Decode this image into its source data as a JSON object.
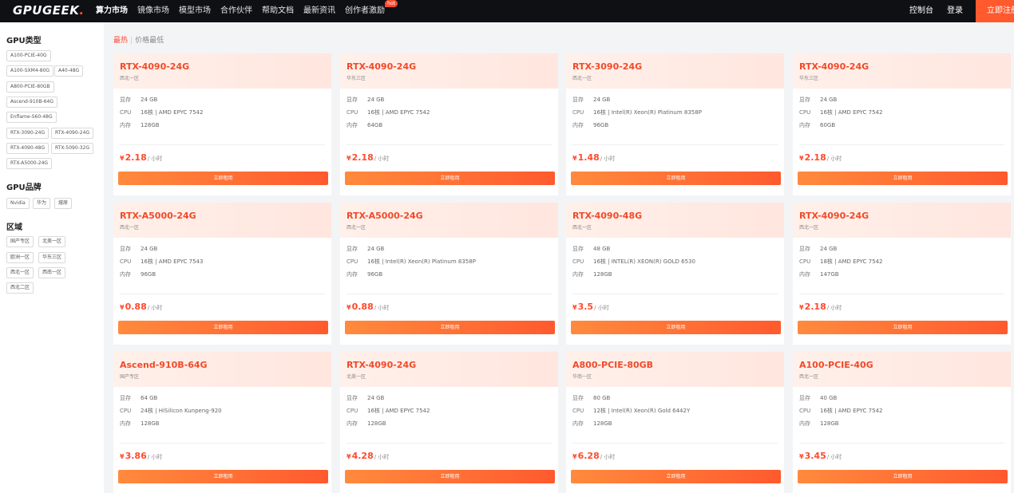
{
  "header": {
    "logo_text": "GPUGEEK",
    "logo_dot": ".",
    "nav": [
      {
        "label": "算力市场"
      },
      {
        "label": "镜像市场"
      },
      {
        "label": "模型市场"
      },
      {
        "label": "合作伙伴"
      },
      {
        "label": "帮助文档"
      },
      {
        "label": "最新资讯"
      },
      {
        "label": "创作者激励",
        "badge": "hot"
      }
    ],
    "console": "控制台",
    "login": "登录",
    "register": "立即注册"
  },
  "sidebar": {
    "gpu_type_title": "GPU类型",
    "gpu_types": [
      "A100-PCIE-40G",
      "A100-SXM4-80G",
      "A40-48G",
      "A800-PCIE-80GB",
      "Ascend-910B-64G",
      "Enflame-S60-48G",
      "RTX-3090-24G",
      "RTX-4090-24G",
      "RTX-4090-48G",
      "RTX-5090-32G",
      "RTX-A5000-24G"
    ],
    "brand_title": "GPU品牌",
    "brands": [
      "Nvidia",
      "华为",
      "燧原"
    ],
    "region_title": "区域",
    "regions": [
      "国产专区",
      "北美一区",
      "欧洲一区",
      "华东三区",
      "西北一区",
      "西南一区",
      "西北二区"
    ]
  },
  "sort": {
    "active": "最热",
    "separator": "|",
    "other": "价格最低"
  },
  "labels": {
    "vram": "显存",
    "cpu": "CPU",
    "mem": "内存",
    "currency": "¥",
    "unit": "/ 小时",
    "rent": "立即租用"
  },
  "cards": [
    {
      "name": "RTX-4090-24G",
      "region": "西北一区",
      "vram": "24 GB",
      "cpu": "16核 | AMD EPYC 7542",
      "mem": "128GB",
      "price": "2.18"
    },
    {
      "name": "RTX-4090-24G",
      "region": "华东三区",
      "vram": "24 GB",
      "cpu": "16核 | AMD EPYC 7542",
      "mem": "64GB",
      "price": "2.18"
    },
    {
      "name": "RTX-3090-24G",
      "region": "西北一区",
      "vram": "24 GB",
      "cpu": "16核 | Intel(R) Xeon(R) Platinum 8358P",
      "mem": "96GB",
      "price": "1.48"
    },
    {
      "name": "RTX-4090-24G",
      "region": "华东三区",
      "vram": "24 GB",
      "cpu": "16核 | AMD EPYC 7542",
      "mem": "60GB",
      "price": "2.18"
    },
    {
      "name": "RTX-A5000-24G",
      "region": "西北一区",
      "vram": "24 GB",
      "cpu": "16核 | AMD EPYC 7543",
      "mem": "96GB",
      "price": "0.88"
    },
    {
      "name": "RTX-A5000-24G",
      "region": "西北一区",
      "vram": "24 GB",
      "cpu": "16核 | Intel(R) Xeon(R) Platinum 8358P",
      "mem": "96GB",
      "price": "0.88"
    },
    {
      "name": "RTX-4090-48G",
      "region": "西北一区",
      "vram": "48 GB",
      "cpu": "16核 | INTEL(R) XEON(R) GOLD 6530",
      "mem": "128GB",
      "price": "3.5"
    },
    {
      "name": "RTX-4090-24G",
      "region": "西北一区",
      "vram": "24 GB",
      "cpu": "18核 | AMD EPYC 7542",
      "mem": "147GB",
      "price": "2.18"
    },
    {
      "name": "Ascend-910B-64G",
      "region": "国产专区",
      "vram": "64 GB",
      "cpu": "24核 | HiSilicon Kunpeng-920",
      "mem": "128GB",
      "price": "3.86"
    },
    {
      "name": "RTX-4090-24G",
      "region": "北美一区",
      "vram": "24 GB",
      "cpu": "16核 | AMD EPYC 7542",
      "mem": "128GB",
      "price": "4.28"
    },
    {
      "name": "A800-PCIE-80GB",
      "region": "华南一区",
      "vram": "80 GB",
      "cpu": "12核 | Intel(R) Xeon(R) Gold 6442Y",
      "mem": "128GB",
      "price": "6.28"
    },
    {
      "name": "A100-PCIE-40G",
      "region": "西北一区",
      "vram": "40 GB",
      "cpu": "16核 | AMD EPYC 7542",
      "mem": "128GB",
      "price": "3.45"
    }
  ]
}
